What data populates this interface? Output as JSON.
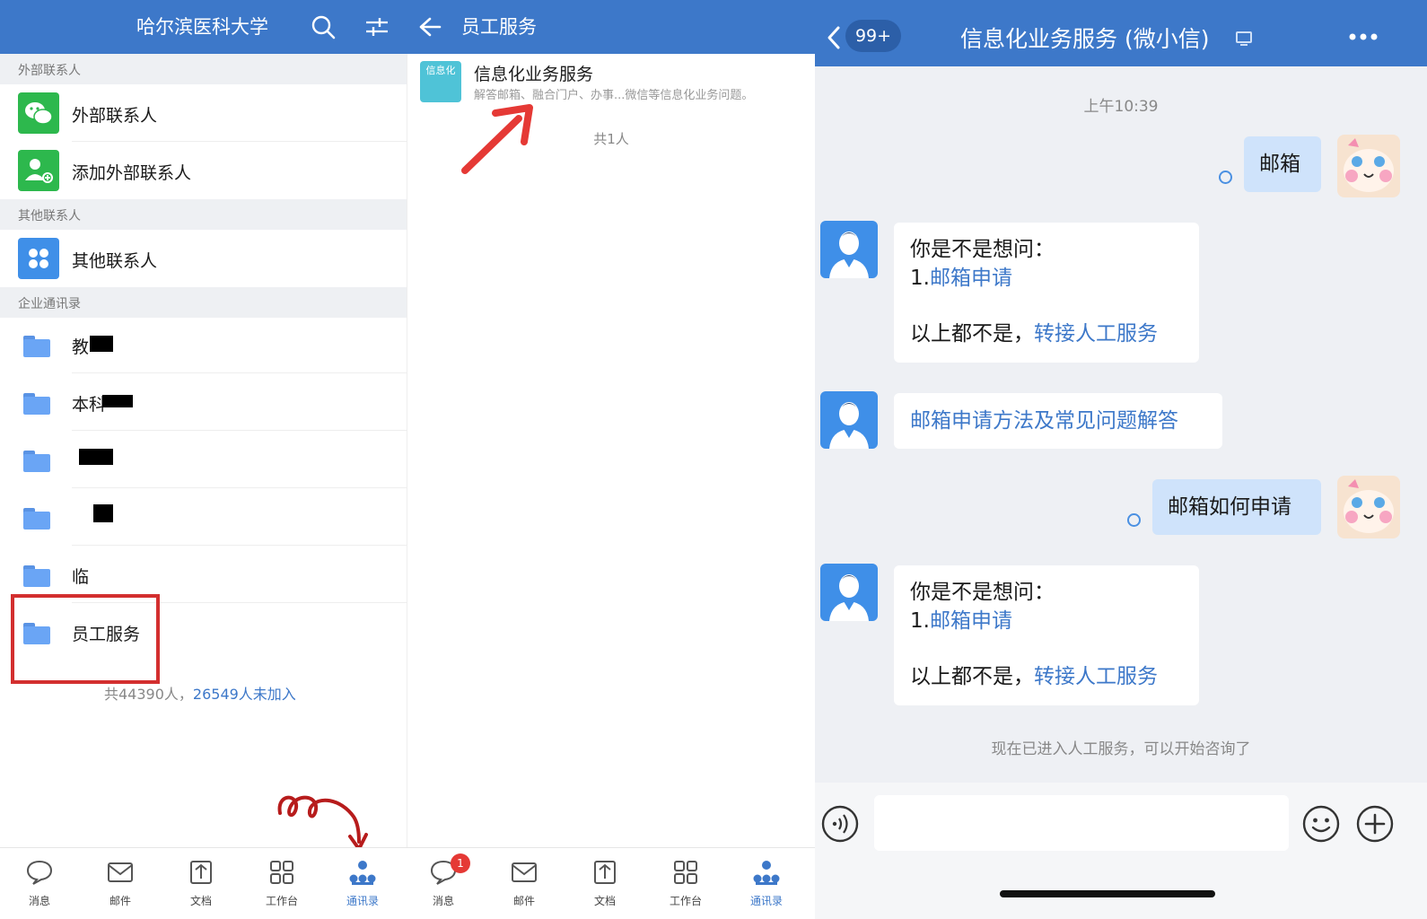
{
  "contacts": {
    "title": "哈尔滨医科大学",
    "sections": {
      "external": "外部联系人",
      "other": "其他联系人",
      "enterprise": "企业通讯录"
    },
    "rows": {
      "external_contacts": "外部联系人",
      "add_external": "添加外部联系人",
      "other_contacts": "其他联系人",
      "folder1": "教",
      "folder2": "本科",
      "folder3": "",
      "folder4": "",
      "folder5": "临",
      "staff_service": "员工服务"
    },
    "footer": {
      "count": "共44390人，",
      "not_joined": "26549人未加入"
    }
  },
  "staff": {
    "title": "员工服务",
    "service_name": "信息化业务服务",
    "service_icon_text": "信息化",
    "service_desc": "解答邮箱、融合门户、办事...微信等信息化业务问题。",
    "count": "共1人"
  },
  "tabbar": {
    "tabs": [
      "消息",
      "邮件",
      "文档",
      "工作台",
      "通讯录"
    ],
    "badge": "1"
  },
  "chat": {
    "back_badge": "99+",
    "title": "信息化业务服务 (微小信)",
    "timestamp": "上午10:39",
    "msg1": "邮箱",
    "reply_q": "你是不是想问：",
    "reply_num": "1.",
    "reply_link": "邮箱申请",
    "reply_none": "以上都不是，",
    "reply_transfer": "转接人工服务",
    "faq_link": "邮箱申请方法及常见问题解答",
    "msg2": "邮箱如何申请",
    "reply2_q": "你是不是想问：",
    "reply2_num": "1.",
    "reply2_link": "邮箱申请",
    "reply2_none": "以上都不是，",
    "reply2_transfer": "转接人工服务",
    "system_note": "现在已进入人工服务，可以开始咨询了"
  },
  "colors": {
    "brand": "#3d78c9",
    "highlight": "#d32f2f",
    "wechat_green": "#2db84d"
  }
}
